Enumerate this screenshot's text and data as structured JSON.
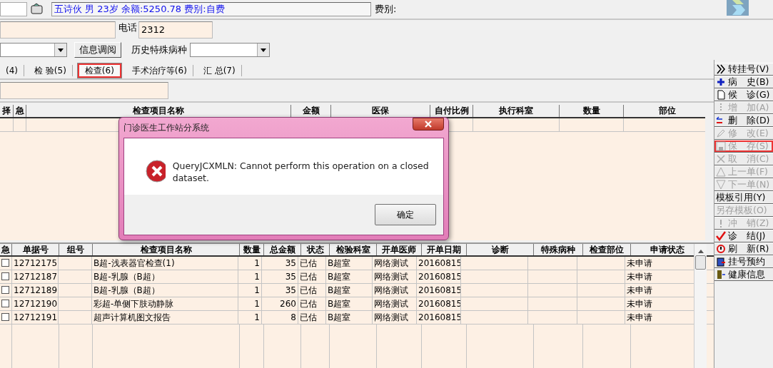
{
  "patient_info": "五诗伙 男 23岁 余额:5250.78 费别:自费",
  "fee_label": "费别:",
  "phone": {
    "label": "电话",
    "value": "2312"
  },
  "info_button": "信息调阅",
  "history_label": "历史特殊病种",
  "tabs": [
    {
      "label": "(4)",
      "selected": false,
      "highlighted": false
    },
    {
      "label": "检 验(5)",
      "selected": false,
      "highlighted": false
    },
    {
      "label": "检查(6)",
      "selected": true,
      "highlighted": true
    },
    {
      "label": "手术治疗等(6)",
      "selected": false,
      "highlighted": false
    },
    {
      "label": "汇 总(7)",
      "selected": false,
      "highlighted": false
    }
  ],
  "upper_table": {
    "columns": [
      "择",
      "急",
      "检查项目名称",
      "金额",
      "医保",
      "自付比例",
      "执行科室",
      "数量",
      "部位"
    ]
  },
  "lower_table": {
    "columns": [
      "急",
      "单据号",
      "组号",
      "检查项目名称",
      "数量",
      "总金额",
      "状态",
      "检验科室",
      "开单医师",
      "开单日期",
      "诊断",
      "特殊病种",
      "检查部位",
      "申请状态"
    ],
    "rows": [
      {
        "checked": false,
        "cells": [
          "",
          "12712175",
          "",
          "B超-浅表器官检查(1)",
          "1",
          "35",
          "已估",
          "B超室",
          "网络测试",
          "20160815",
          "",
          "",
          "",
          "未申请"
        ]
      },
      {
        "checked": false,
        "cells": [
          "",
          "12712187",
          "",
          "B超-乳腺（B超）",
          "1",
          "35",
          "已估",
          "B超室",
          "网络测试",
          "20160815",
          "",
          "",
          "",
          "未申请"
        ]
      },
      {
        "checked": false,
        "cells": [
          "",
          "12712189",
          "",
          "B超-乳腺（B超）",
          "1",
          "35",
          "已估",
          "B超室",
          "网络测试",
          "20160815",
          "",
          "",
          "",
          "未申请"
        ]
      },
      {
        "checked": false,
        "cells": [
          "",
          "12712190",
          "",
          "彩超-单侧下肢动静脉",
          "1",
          "260",
          "已估",
          "B超室",
          "网络测试",
          "20160815",
          "",
          "",
          "",
          "未申请"
        ]
      },
      {
        "checked": false,
        "cells": [
          "",
          "12712191",
          "",
          "超声计算机图文报告",
          "1",
          "8",
          "已估",
          "B超室",
          "网络测试",
          "20160815",
          "",
          "",
          "",
          "未申请"
        ]
      }
    ]
  },
  "side_buttons": [
    {
      "label": "转挂号(V)",
      "disabled": false,
      "highlighted": false
    },
    {
      "label": "病　史(B)",
      "disabled": false,
      "highlighted": false
    },
    {
      "label": "候　诊(G)",
      "disabled": false,
      "highlighted": false
    },
    {
      "label": "增　加(A)",
      "disabled": true,
      "highlighted": false
    },
    {
      "label": "删　除(D)",
      "disabled": false,
      "highlighted": false
    },
    {
      "label": "修　改(E)",
      "disabled": true,
      "highlighted": false
    },
    {
      "label": "保　存(S)",
      "disabled": true,
      "highlighted": true
    },
    {
      "label": "取　消(C)",
      "disabled": true,
      "highlighted": false
    },
    {
      "label": "上一单(F)",
      "disabled": true,
      "highlighted": false
    },
    {
      "label": "下一单(N)",
      "disabled": true,
      "highlighted": false
    },
    {
      "label": "模板引用(Y)",
      "disabled": false,
      "highlighted": false
    },
    {
      "label": "另存模板(O)",
      "disabled": true,
      "highlighted": false
    },
    {
      "label": "冲　销(Z)",
      "disabled": true,
      "highlighted": false
    },
    {
      "label": "诊　结(J)",
      "disabled": false,
      "highlighted": false
    },
    {
      "label": "刷　新(R)",
      "disabled": false,
      "highlighted": false
    },
    {
      "label": "挂号预约",
      "disabled": false,
      "highlighted": false
    },
    {
      "label": "健康信息",
      "disabled": false,
      "highlighted": false
    }
  ],
  "dialog": {
    "title": "门诊医生工作站分系统",
    "message": "QueryJCXMLN: Cannot perform this operation on a closed dataset.",
    "button": "确定"
  }
}
